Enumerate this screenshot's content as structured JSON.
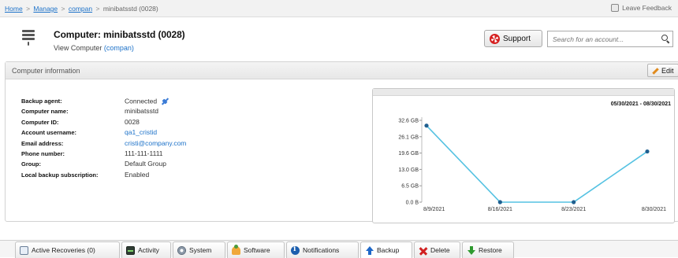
{
  "breadcrumb": {
    "items": [
      "Home",
      "Manage",
      "compan",
      "minibatsstd (0028)"
    ],
    "separator": ">"
  },
  "header": {
    "feedback_label": "Leave Feedback",
    "title": "Computer: minibatsstd (0028)",
    "subtitle_prefix": "View Computer",
    "subtitle_link": "(compan)",
    "support_label": "Support",
    "search_placeholder": "Search for an account..."
  },
  "panel": {
    "title": "Computer information",
    "edit_label": "Edit",
    "fields": [
      {
        "label": "Backup agent:",
        "value": "Connected",
        "link": false
      },
      {
        "label": "Computer name:",
        "value": "minibatsstd",
        "link": false
      },
      {
        "label": "Computer ID:",
        "value": "0028",
        "link": false
      },
      {
        "label": "Account username:",
        "value": "qa1_cristid",
        "link": true
      },
      {
        "label": "Email address:",
        "value": "cristi@company.com",
        "link": true
      },
      {
        "label": "Phone number:",
        "value": "111-111-1111",
        "link": false
      },
      {
        "label": "Group:",
        "value": "Default Group",
        "link": false
      },
      {
        "label": "Local backup subscription:",
        "value": "Enabled",
        "link": false
      }
    ]
  },
  "chart_data": {
    "type": "line",
    "date_range": "05/30/2021 - 08/30/2021",
    "x": [
      "8/9/2021",
      "8/16/2021",
      "8/23/2021",
      "8/30/2021"
    ],
    "y_ticks": [
      "0.0 B",
      "6.5 GB",
      "13.0 GB",
      "19.6 GB",
      "26.1 GB",
      "32.6 GB"
    ],
    "ylim": [
      0,
      32.6
    ],
    "y_unit": "GB",
    "series": [
      {
        "values": [
          30.5,
          0.0,
          0.0,
          20.2
        ]
      }
    ],
    "grid": false,
    "colors": {
      "line": "#55c2e2",
      "point": "#1f5f8f"
    }
  },
  "tabs": [
    {
      "label": "Active Recoveries (0)",
      "icon": "recover-icon",
      "active": false
    },
    {
      "label": "Activity",
      "icon": "activity-icon",
      "active": false
    },
    {
      "label": "System",
      "icon": "system-icon",
      "active": false
    },
    {
      "label": "Software",
      "icon": "software-icon",
      "active": false
    },
    {
      "label": "Notifications",
      "icon": "notifications-icon",
      "active": false
    },
    {
      "label": "Backup",
      "icon": "backup-icon",
      "active": true
    },
    {
      "label": "Delete",
      "icon": "delete-icon",
      "active": false
    },
    {
      "label": "Restore",
      "icon": "restore-icon",
      "active": false
    }
  ]
}
